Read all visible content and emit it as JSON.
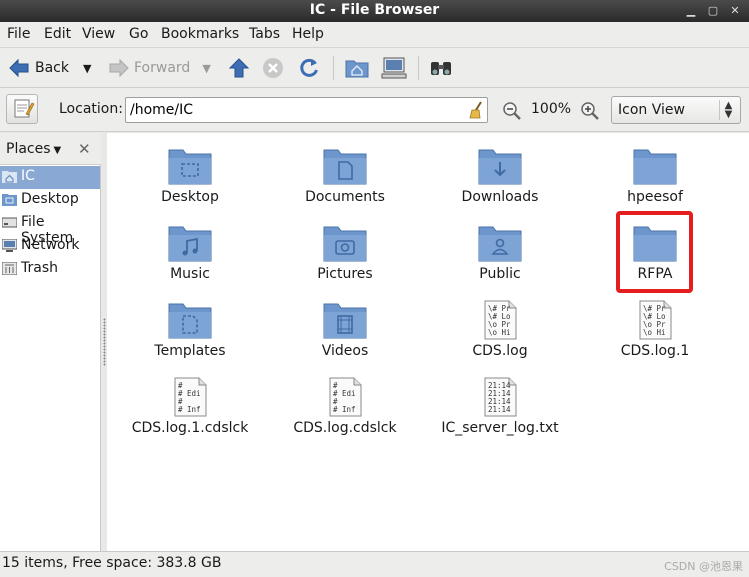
{
  "window": {
    "title": "IC - File Browser"
  },
  "menu": [
    "File",
    "Edit",
    "View",
    "Go",
    "Bookmarks",
    "Tabs",
    "Help"
  ],
  "toolbar": {
    "back": "Back",
    "forward": "Forward"
  },
  "location": {
    "label": "Location:",
    "path": "/home/IC",
    "zoom": "100%",
    "view": "Icon View"
  },
  "sidebar": {
    "header": "Places",
    "items": [
      {
        "label": "IC",
        "icon": "home-icon",
        "selected": true
      },
      {
        "label": "Desktop",
        "icon": "desktop-icon"
      },
      {
        "label": "File System",
        "icon": "drive-icon"
      },
      {
        "label": "Network",
        "icon": "network-icon"
      },
      {
        "label": "Trash",
        "icon": "trash-icon"
      }
    ]
  },
  "files": [
    {
      "name": "Desktop",
      "type": "folder",
      "emblem": "desktop"
    },
    {
      "name": "Documents",
      "type": "folder",
      "emblem": "documents"
    },
    {
      "name": "Downloads",
      "type": "folder",
      "emblem": "download"
    },
    {
      "name": "hpeesof",
      "type": "folder",
      "emblem": ""
    },
    {
      "name": "Music",
      "type": "folder",
      "emblem": "music"
    },
    {
      "name": "Pictures",
      "type": "folder",
      "emblem": "camera"
    },
    {
      "name": "Public",
      "type": "folder",
      "emblem": "person"
    },
    {
      "name": "RFPA",
      "type": "folder",
      "emblem": "",
      "highlighted": true
    },
    {
      "name": "Templates",
      "type": "folder",
      "emblem": "template"
    },
    {
      "name": "Videos",
      "type": "folder",
      "emblem": "film"
    },
    {
      "name": "CDS.log",
      "type": "text",
      "preview": [
        "\\# Pr",
        "\\# Lo",
        "\\o Pr",
        "\\o Hi"
      ]
    },
    {
      "name": "CDS.log.1",
      "type": "text",
      "preview": [
        "\\# Pr",
        "\\# Lo",
        "\\o Pr",
        "\\o Hi"
      ]
    },
    {
      "name": "CDS.log.1.cdslck",
      "type": "text",
      "preview": [
        "#",
        "# Edi",
        "#",
        "# Inf"
      ]
    },
    {
      "name": "CDS.log.cdslck",
      "type": "text",
      "preview": [
        "#",
        "# Edi",
        "#",
        "# Inf"
      ]
    },
    {
      "name": "IC_server_log.txt",
      "type": "text",
      "preview": [
        "21:14",
        "21:14",
        "21:14",
        "21:14"
      ]
    }
  ],
  "status": "15 items, Free space: 383.8 GB",
  "watermark": "CSDN @池恩果",
  "colors": {
    "folder": "#6d96cc",
    "selection": "#8aa8d4",
    "highlight": "#e41e1e"
  }
}
